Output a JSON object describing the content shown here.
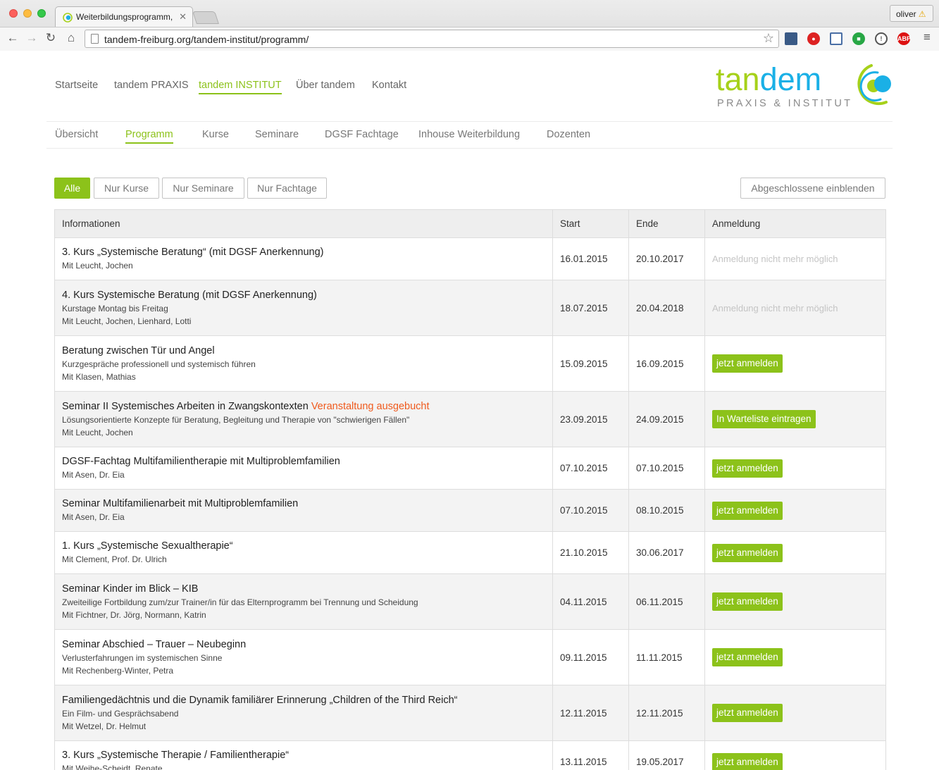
{
  "browser": {
    "tab_title": "Weiterbildungsprogramm, ",
    "url": "tandem-freiburg.org/tandem-institut/programm/",
    "user": "oliver",
    "extensions": [
      "puzzle-icon",
      "stop-icon",
      "screen-icon",
      "lock-icon",
      "info-icon",
      "abp-icon"
    ],
    "abp_label": "ABP"
  },
  "site": {
    "main_nav": [
      "Startseite",
      "tandem PRAXIS",
      "tandem INSTITUT",
      "Über tandem",
      "Kontakt"
    ],
    "main_nav_active": "tandem INSTITUT",
    "logo": {
      "word_a": "tan",
      "word_b": "dem",
      "sub": "PRAXIS & INSTITUT"
    },
    "sub_nav": [
      "Übersicht",
      "Programm",
      "Kurse",
      "Seminare",
      "DGSF Fachtage",
      "Inhouse Weiterbildung",
      "Dozenten"
    ],
    "sub_nav_active": "Programm",
    "filters": [
      "Alle",
      "Nur Kurse",
      "Nur Seminare",
      "Nur Fachtage"
    ],
    "filter_active": "Alle",
    "show_closed": "Abgeschlossene einblenden",
    "accent": "#8cc21a",
    "accent_blue": "#1ab0e6",
    "full_color": "#ef5a1d"
  },
  "table": {
    "headers": [
      "Informationen",
      "Start",
      "Ende",
      "Anmeldung"
    ],
    "rows": [
      {
        "title": "3. Kurs „Systemische Beratung“ (mit DGSF Anerkennung)",
        "full": "",
        "lines": [
          "Mit Leucht, Jochen"
        ],
        "start": "16.01.2015",
        "end": "20.10.2017",
        "action": "Anmeldung nicht mehr möglich",
        "action_type": "closed"
      },
      {
        "title": "4. Kurs Systemische Beratung (mit DGSF Anerkennung)",
        "full": "",
        "lines": [
          "Kurstage Montag bis Freitag",
          "Mit Leucht, Jochen, Lienhard, Lotti"
        ],
        "start": "18.07.2015",
        "end": "20.04.2018",
        "action": "Anmeldung nicht mehr möglich",
        "action_type": "closed"
      },
      {
        "title": "Beratung zwischen Tür und Angel",
        "full": "",
        "lines": [
          "Kurzgespräche professionell und systemisch führen",
          "Mit Klasen, Mathias"
        ],
        "start": "15.09.2015",
        "end": "16.09.2015",
        "action": "jetzt anmelden",
        "action_type": "button"
      },
      {
        "title": "Seminar II Systemisches Arbeiten in Zwangskontexten",
        "full": "Veranstaltung ausgebucht",
        "lines": [
          "Lösungsorientierte Konzepte für Beratung, Begleitung und Therapie von \"schwierigen Fällen\"",
          "Mit Leucht, Jochen"
        ],
        "start": "23.09.2015",
        "end": "24.09.2015",
        "action": "In Warteliste eintragen",
        "action_type": "button"
      },
      {
        "title": "DGSF-Fachtag Multifamilientherapie mit Multiproblemfamilien",
        "full": "",
        "lines": [
          "Mit Asen, Dr. Eia"
        ],
        "start": "07.10.2015",
        "end": "07.10.2015",
        "action": "jetzt anmelden",
        "action_type": "button"
      },
      {
        "title": "Seminar Multifamilienarbeit mit Multiproblemfamilien",
        "full": "",
        "lines": [
          "Mit Asen, Dr. Eia"
        ],
        "start": "07.10.2015",
        "end": "08.10.2015",
        "action": "jetzt anmelden",
        "action_type": "button"
      },
      {
        "title": "1. Kurs „Systemische Sexualtherapie“",
        "full": "",
        "lines": [
          "Mit Clement, Prof. Dr. Ulrich"
        ],
        "start": "21.10.2015",
        "end": "30.06.2017",
        "action": "jetzt anmelden",
        "action_type": "button"
      },
      {
        "title": "Seminar Kinder im Blick – KIB",
        "full": "",
        "lines": [
          "Zweiteilige Fortbildung zum/zur Trainer/in für das Elternprogramm bei Trennung und Scheidung",
          "Mit Fichtner, Dr. Jörg, Normann, Katrin"
        ],
        "start": "04.11.2015",
        "end": "06.11.2015",
        "action": "jetzt anmelden",
        "action_type": "button"
      },
      {
        "title": "Seminar Abschied – Trauer – Neubeginn",
        "full": "",
        "lines": [
          "Verlusterfahrungen im systemischen Sinne",
          "Mit Rechenberg-Winter, Petra"
        ],
        "start": "09.11.2015",
        "end": "11.11.2015",
        "action": "jetzt anmelden",
        "action_type": "button"
      },
      {
        "title": "Familiengedächtnis und die Dynamik familiärer Erinnerung „Children of the Third Reich“",
        "full": "",
        "lines": [
          "Ein Film- und Gesprächsabend",
          "Mit Wetzel, Dr. Helmut"
        ],
        "start": "12.11.2015",
        "end": "12.11.2015",
        "action": "jetzt anmelden",
        "action_type": "button"
      },
      {
        "title": "3. Kurs „Systemische Therapie / Familientherapie“",
        "full": "",
        "lines": [
          "Mit Weihe-Scheidt, Renate"
        ],
        "start": "13.11.2015",
        "end": "19.05.2017",
        "action": "jetzt anmelden",
        "action_type": "button"
      }
    ]
  }
}
